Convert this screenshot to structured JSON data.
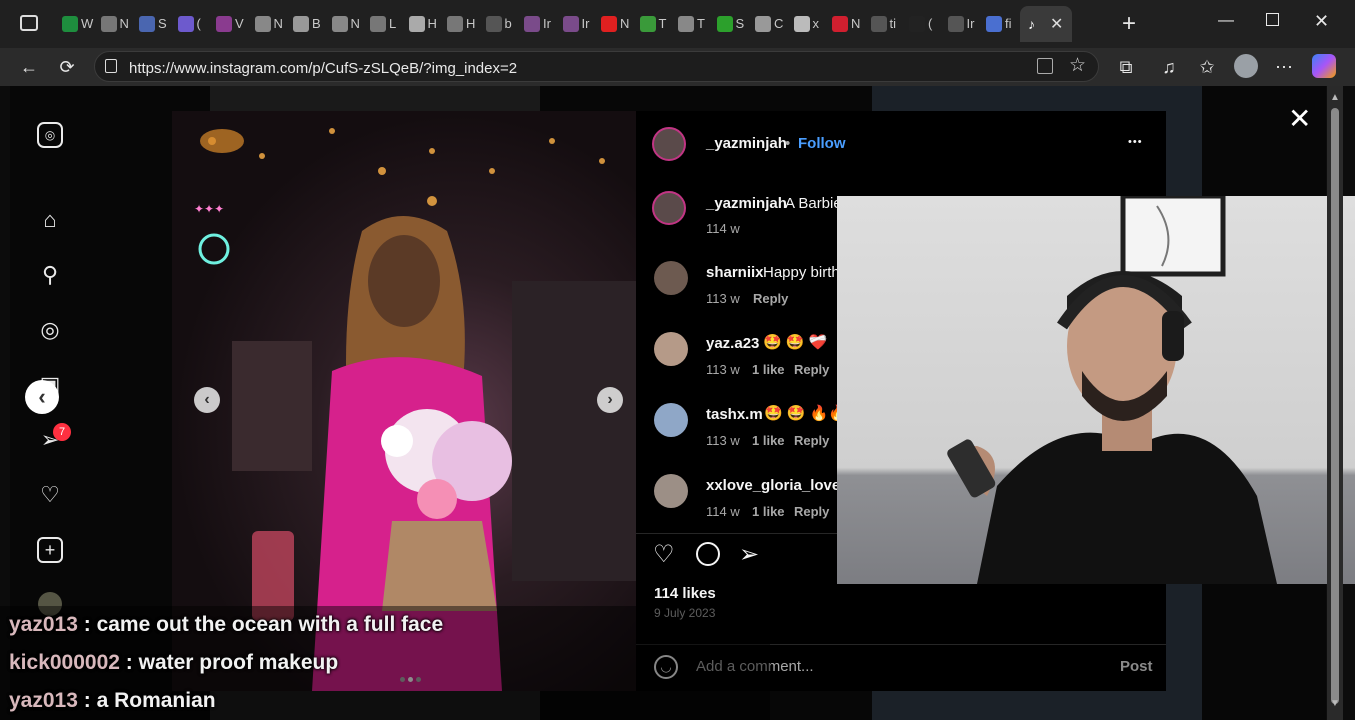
{
  "browser": {
    "tabs_letters": [
      "W",
      "N",
      "S",
      "(",
      "V",
      "N",
      "B",
      "N",
      "L",
      "H",
      "H",
      "b",
      "Ir",
      "Ir",
      "N",
      "T",
      "T",
      "S",
      "C",
      "x",
      "N",
      "ti",
      "(",
      "Ir",
      "fi"
    ],
    "url": "https://www.instagram.com/p/CufS-zSLQeB/?img_index=2"
  },
  "ig_sidebar": {
    "notification_count": "7"
  },
  "post": {
    "author": "_yazminjah",
    "separator": "•",
    "follow_label": "Follow",
    "more_label": "•••",
    "caption_user": "_yazminjah",
    "caption_text": "A Barbie",
    "caption_age": "114 w",
    "comments": [
      {
        "user": "sharniix",
        "text": "Happy birth",
        "age": "113 w",
        "likes": "",
        "reply": "Reply"
      },
      {
        "user": "yaz.a23",
        "text": "🤩 🤩 ❤️‍🩹",
        "age": "113 w",
        "likes": "1 like",
        "reply": "Reply"
      },
      {
        "user": "tashx.m",
        "text": "🤩 🤩 🔥🔥",
        "age": "113 w",
        "likes": "1 like",
        "reply": "Reply"
      },
      {
        "user": "xxlove_gloria_lovex",
        "text": "",
        "age": "114 w",
        "likes": "1 like",
        "reply": "Reply"
      }
    ],
    "likes": "114 likes",
    "date": "9 July 2023",
    "comment_placeholder": "Add a comment...",
    "post_label": "Post"
  },
  "chat": [
    {
      "user": "yaz013",
      "message": " : came out the ocean with a full face"
    },
    {
      "user": "kick000002",
      "message": " : water proof makeup"
    },
    {
      "user": "yaz013",
      "message": " : a Romanian"
    }
  ],
  "colors": {
    "follow": "#4a9eff",
    "badge": "#ff3040",
    "chat_user": "#d8b8bc"
  }
}
